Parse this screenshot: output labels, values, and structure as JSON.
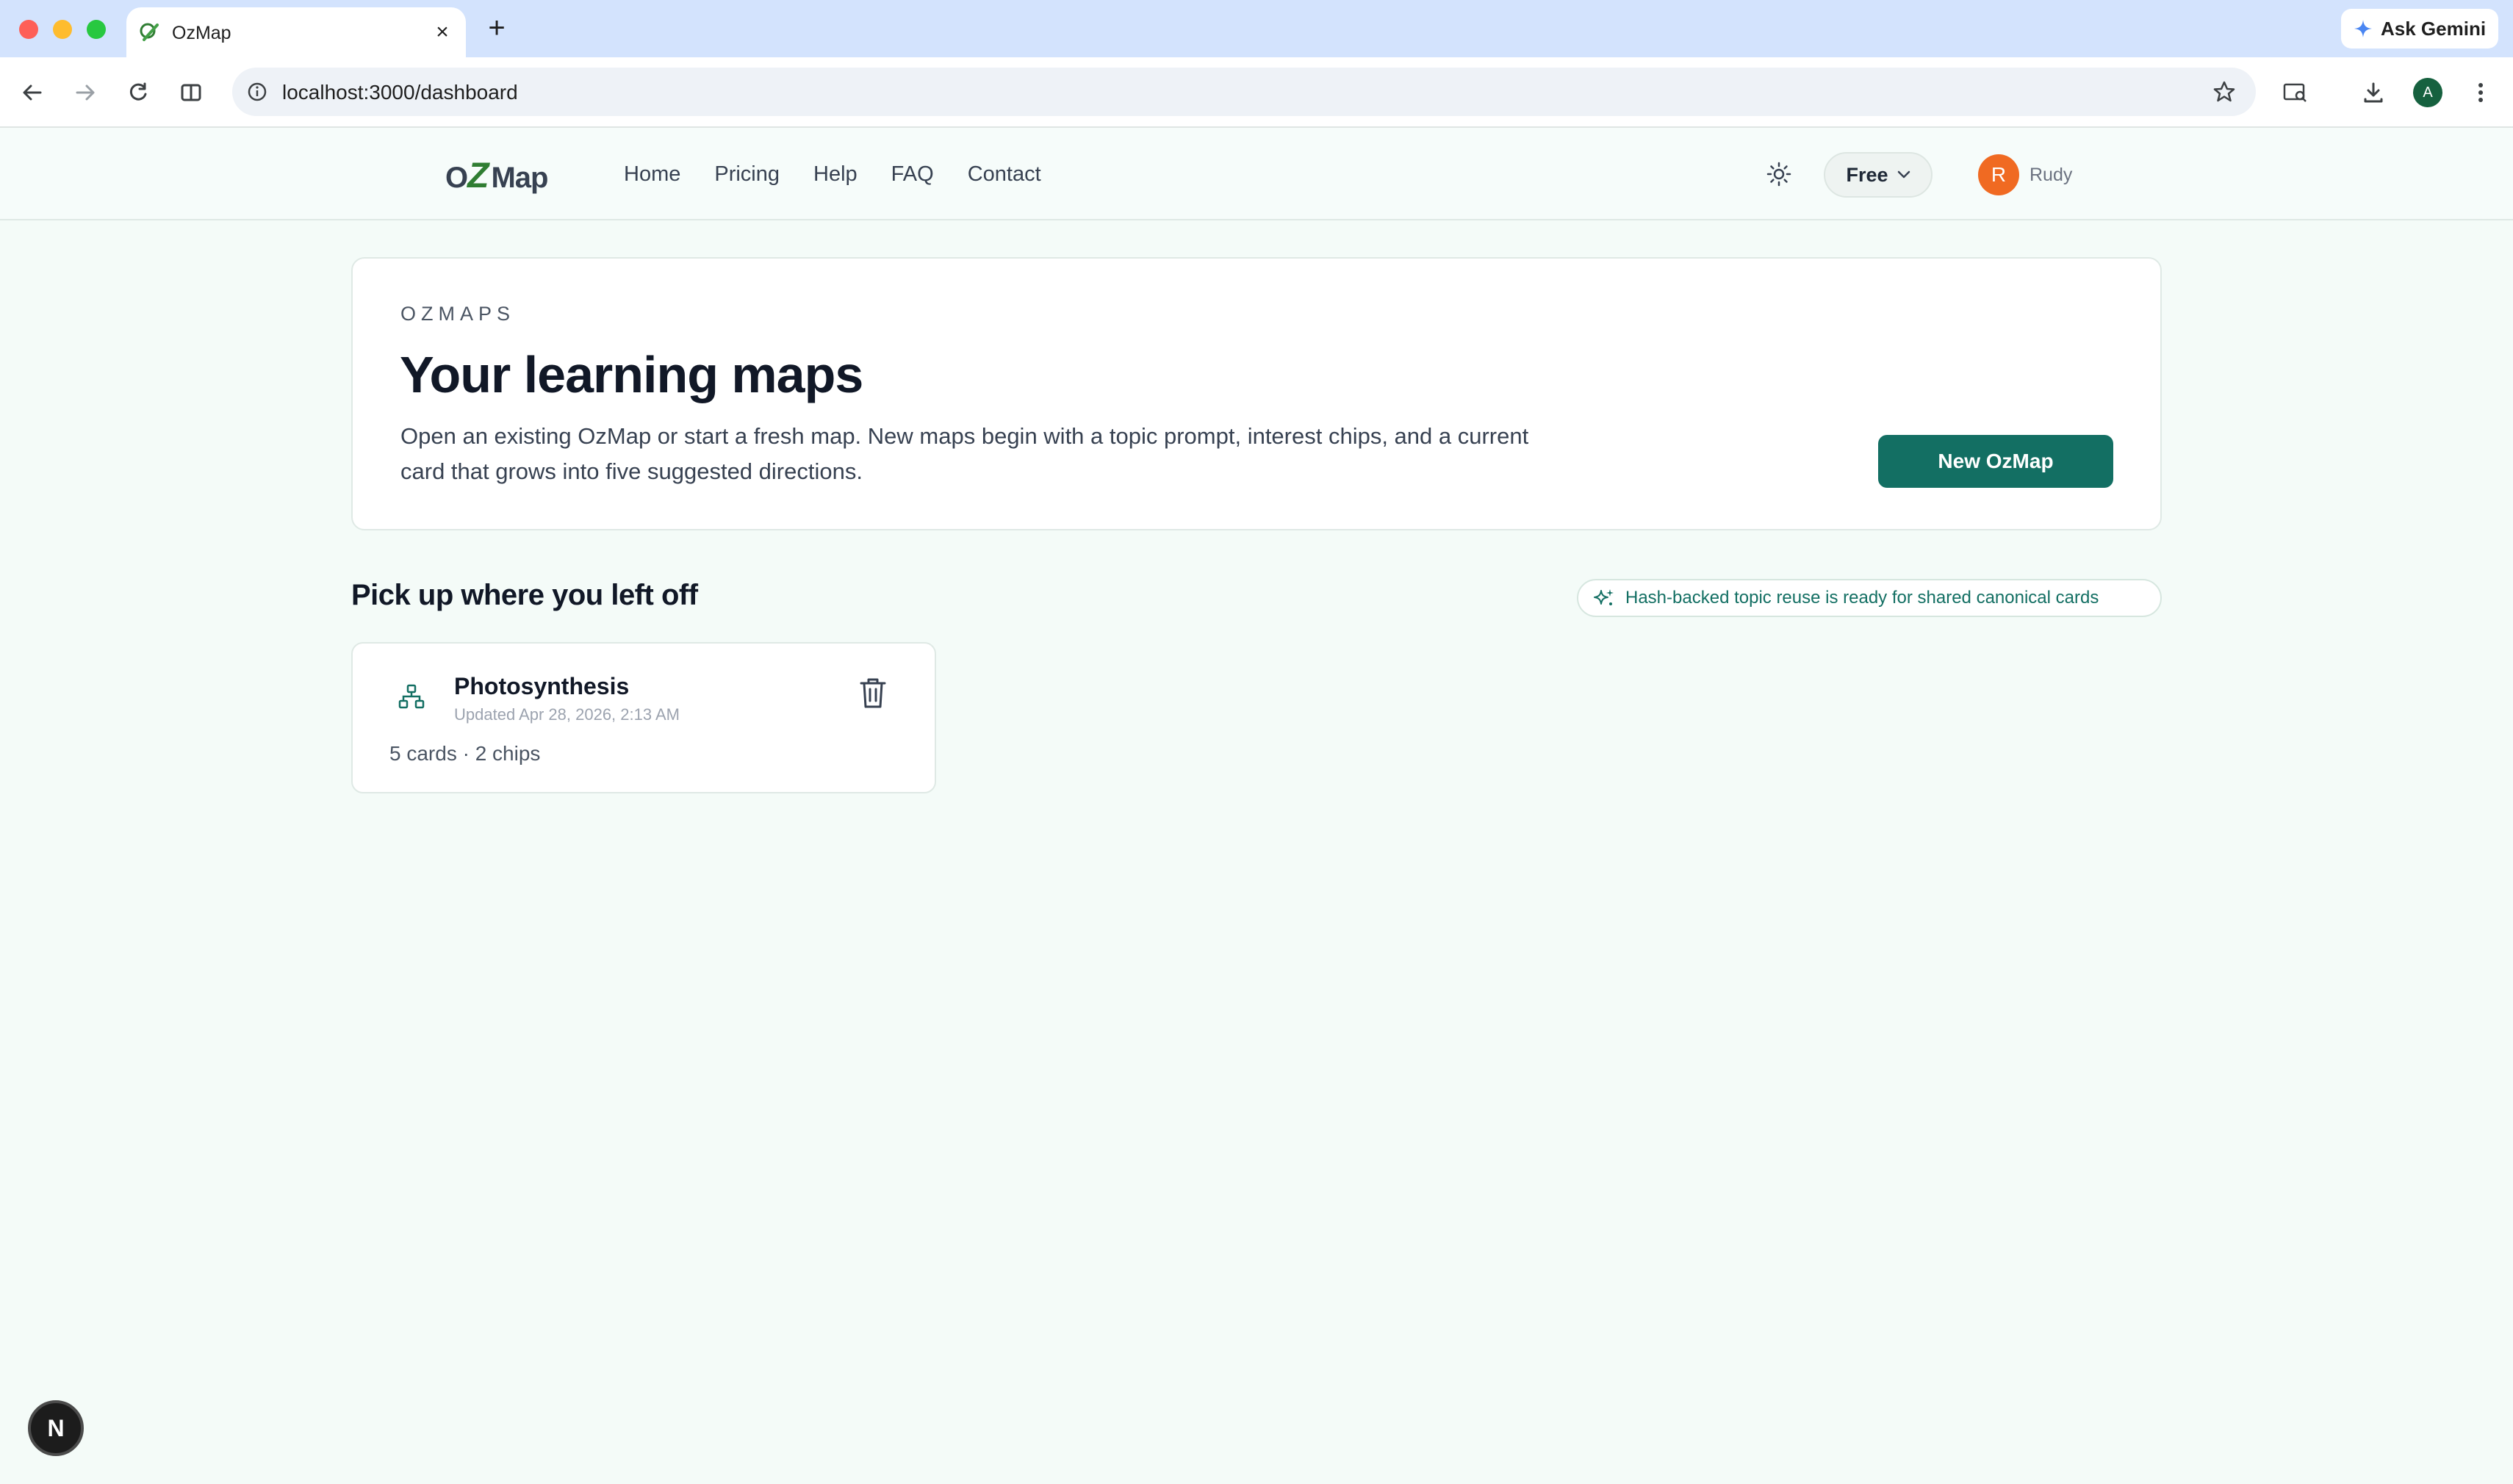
{
  "browser": {
    "tab_title": "OzMap",
    "tab_close": "×",
    "new_tab": "+",
    "url": "localhost:3000/dashboard",
    "gemini_label": "Ask Gemini",
    "profile_initial": "A"
  },
  "header": {
    "logo_text": "OZMap",
    "nav": [
      "Home",
      "Pricing",
      "Help",
      "FAQ",
      "Contact"
    ],
    "plan_label": "Free",
    "user_initial": "R",
    "user_name": "Rudy"
  },
  "hero": {
    "eyebrow": "OZMAPS",
    "title": "Your learning maps",
    "description": "Open an existing OzMap or start a fresh map. New maps begin with a topic prompt, interest chips, and a current card that grows into five suggested directions.",
    "button_label": "New OzMap"
  },
  "section": {
    "title": "Pick up where you left off",
    "badge": "Hash-backed topic reuse is ready for shared canonical cards"
  },
  "maps": [
    {
      "title": "Photosynthesis",
      "updated": "Updated Apr 28, 2026, 2:13 AM",
      "meta": "5 cards · 2 chips"
    }
  ],
  "dev_badge": "N",
  "colors": {
    "accent": "#136f63",
    "user_avatar": "#f06a22",
    "page_bg": "#f4fbf8"
  }
}
